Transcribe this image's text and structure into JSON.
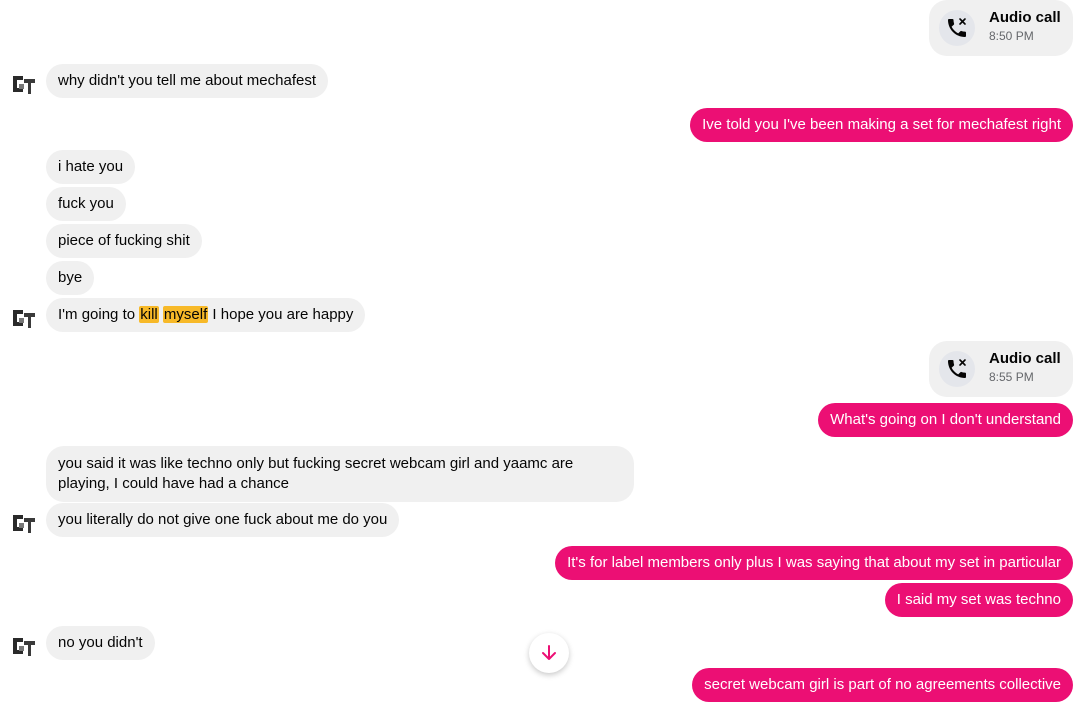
{
  "accent_color": "#ec0f74",
  "calls": [
    {
      "title": "Audio call",
      "time": "8:50 PM",
      "icon": "missed-call-icon"
    },
    {
      "title": "Audio call",
      "time": "8:55 PM",
      "icon": "missed-call-icon"
    }
  ],
  "messages": {
    "m1": "why didn't you tell me about mechafest",
    "m2": "Ive told you I've been making a set for mechafest right",
    "m3": "i hate you",
    "m4": "fuck you",
    "m5": "piece of fucking shit",
    "m6": "bye",
    "m7": {
      "pre": "I'm going to ",
      "hl1": "kill",
      "mid": " ",
      "hl2": "myself",
      "post": " I hope you are happy"
    },
    "m8": "What's going on I don't understand",
    "m9": "you said it was like techno only but fucking secret webcam girl and yaamc are playing, I could have had a chance",
    "m10": "you literally do not give one fuck about me do you",
    "m11": "It's for label members only plus I was saying that about my set in particular",
    "m12": "I said my set was techno",
    "m13": "no you didn't",
    "m14": "secret webcam girl is part of no agreements collective"
  },
  "scroll_button_icon": "arrow-down-icon"
}
